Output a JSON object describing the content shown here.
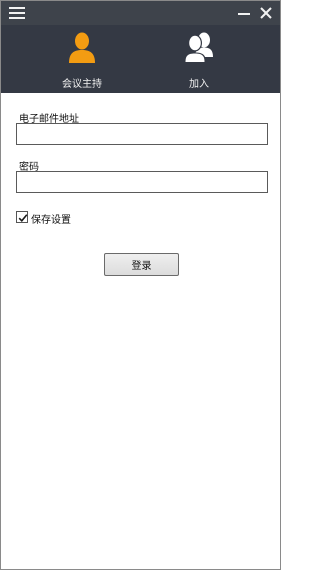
{
  "titlebar": {
    "menu_icon": "hamburger-menu-icon",
    "minimize_icon": "minimize-icon",
    "close_icon": "close-icon",
    "bar_color": "#3e434b"
  },
  "nav": {
    "background": "#343944",
    "tabs": [
      {
        "label": "会议主持",
        "icon": "person-icon",
        "icon_color": "#f39c12",
        "active": true
      },
      {
        "label": "加入",
        "icon": "group-icon",
        "icon_color": "#ffffff",
        "active": false
      }
    ]
  },
  "form": {
    "email_label": "电子邮件地址",
    "email_value": "",
    "email_placeholder": "",
    "password_label": "密码",
    "password_value": "",
    "password_placeholder": "",
    "remember_label": "保存设置",
    "remember_checked": true,
    "login_label": "登录"
  }
}
